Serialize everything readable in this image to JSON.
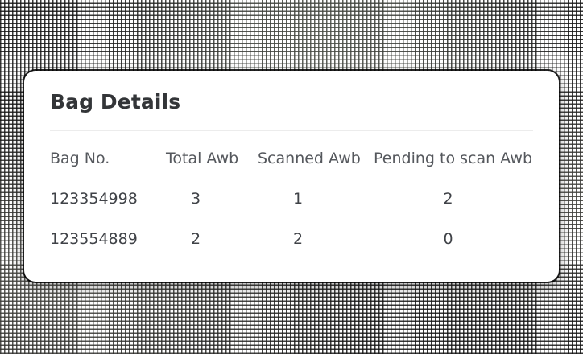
{
  "card": {
    "title": "Bag Details"
  },
  "table": {
    "columns": [
      "Bag No.",
      "Total Awb",
      "Scanned Awb",
      "Pending to scan Awb"
    ],
    "rows": [
      [
        "123354998",
        "3",
        "1",
        "2"
      ],
      [
        "123554889",
        "2",
        "2",
        "0"
      ]
    ]
  }
}
